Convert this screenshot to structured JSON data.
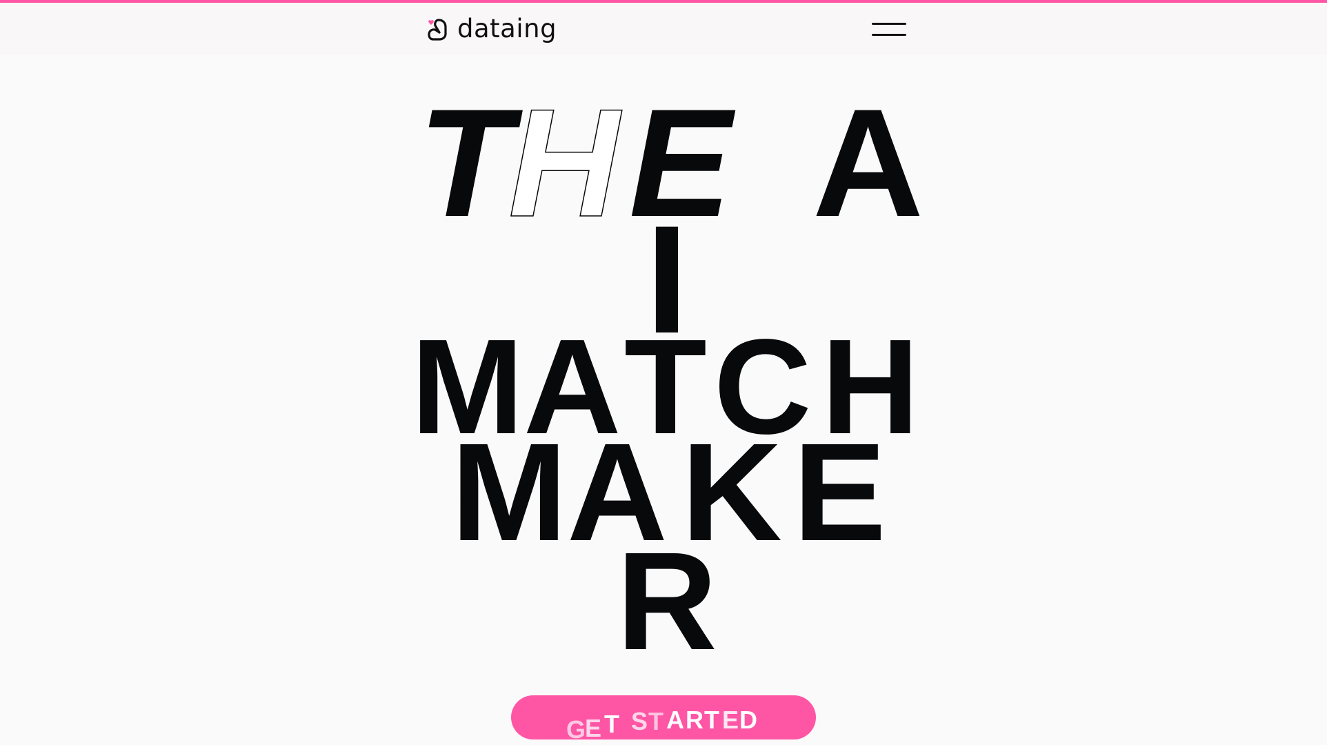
{
  "accent_color": "#ff55a5",
  "brand": {
    "name": "dataing",
    "logo_icon": "heart-loop-icon"
  },
  "nav": {
    "menu_icon": "hamburger-menu-icon"
  },
  "hero": {
    "line_1": [
      "T",
      "H",
      "E",
      "A"
    ],
    "line_2": [
      "I"
    ],
    "line_3": [
      "M",
      "A",
      "T",
      "C",
      "H"
    ],
    "line_4": [
      "M",
      "A",
      "K",
      "E"
    ],
    "line_5": [
      "R"
    ]
  },
  "cta": {
    "chars": [
      "G",
      "E",
      "T",
      "S",
      "T",
      "A",
      "R",
      "T",
      "E",
      "D"
    ]
  }
}
